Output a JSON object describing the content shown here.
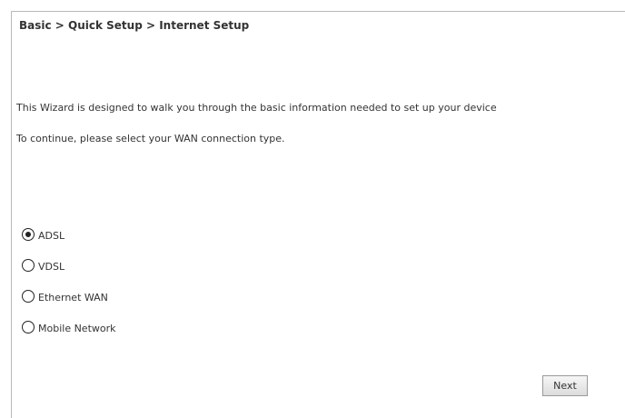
{
  "breadcrumb": "Basic > Quick Setup > Internet Setup",
  "intro": {
    "line1": "This Wizard is designed to walk you through the basic information needed to set up your device",
    "line2": "To continue, please select your WAN connection type."
  },
  "wan_options": [
    {
      "label": "ADSL",
      "selected": true
    },
    {
      "label": "VDSL",
      "selected": false
    },
    {
      "label": "Ethernet WAN",
      "selected": false
    },
    {
      "label": "Mobile Network",
      "selected": false
    }
  ],
  "next_label": "Next",
  "colors": {
    "border": "#b9b9b9",
    "text": "#333333",
    "button_border": "#9a9a9a"
  }
}
